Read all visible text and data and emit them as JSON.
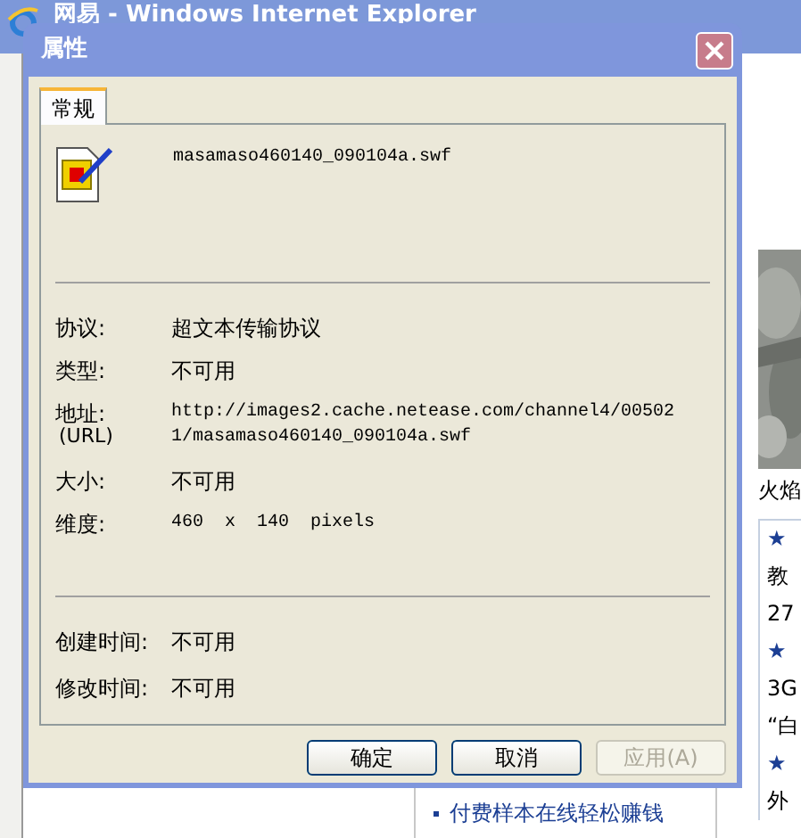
{
  "browser": {
    "title": "网易 - Windows Internet Explorer",
    "caption": "火焰",
    "side_lines": [
      {
        "text": "★",
        "kind": "heading"
      },
      {
        "text": "教",
        "kind": "line"
      },
      {
        "text": "27",
        "kind": "line"
      },
      {
        "text": "★",
        "kind": "heading"
      },
      {
        "text": "3G",
        "kind": "line"
      },
      {
        "text": "“白",
        "kind": "line"
      },
      {
        "text": "★",
        "kind": "heading"
      },
      {
        "text": "外",
        "kind": "line"
      }
    ],
    "link": "付费样本在线轻松赚钱"
  },
  "dialog": {
    "title": "属性",
    "tabs": [
      {
        "label": "常规",
        "selected": true
      }
    ],
    "file_name": "masamaso460140_090104a.swf",
    "sections": [
      {
        "rows": [
          {
            "label": "协议:",
            "value": "超文本传输协议",
            "kind": "text"
          },
          {
            "label": "类型:",
            "value": "不可用",
            "kind": "text"
          },
          {
            "label": "地址:",
            "sublabel": "(URL)",
            "value": "http://images2.cache.netease.com/channel4/005021/masamaso460140_090104a.swf",
            "kind": "code"
          },
          {
            "label": "大小:",
            "value": "不可用",
            "kind": "text"
          },
          {
            "label": "维度:",
            "value": "460  x  140  pixels",
            "kind": "code"
          }
        ]
      },
      {
        "rows": [
          {
            "label": "创建时间:",
            "value": "不可用",
            "kind": "text"
          },
          {
            "label": "修改时间:",
            "value": "不可用",
            "kind": "text"
          }
        ]
      }
    ],
    "buttons": [
      {
        "label": "确定",
        "disabled": false
      },
      {
        "label": "取消",
        "disabled": false
      },
      {
        "label": "应用(A)",
        "disabled": true
      }
    ]
  }
}
